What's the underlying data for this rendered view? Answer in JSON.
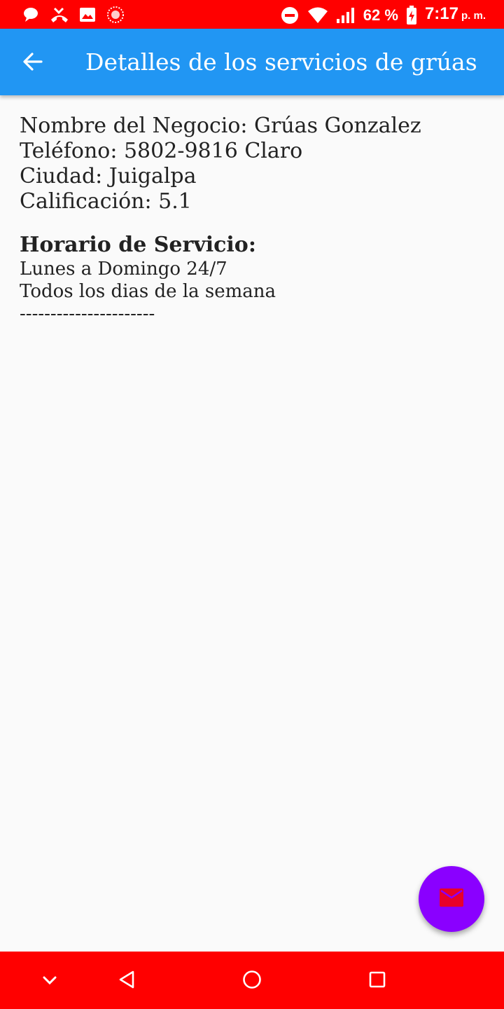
{
  "status_bar": {
    "battery_percent": "62 %",
    "time": "7:17",
    "time_suffix": "p. m.",
    "icons_left": [
      "chat-bubble-icon",
      "missed-call-icon",
      "image-icon",
      "recording-icon"
    ],
    "icons_right": [
      "do-not-disturb-icon",
      "wifi-icon",
      "signal-icon",
      "battery-charging-icon"
    ]
  },
  "app_bar": {
    "title": "Detalles de los servicios de grúas",
    "back_icon": "arrow-back-icon"
  },
  "details": {
    "business_name": "Nombre del Negocio: Grúas Gonzalez",
    "phone": "Teléfono: 5802-9816 Claro",
    "city": "Ciudad: Juigalpa",
    "rating": "Calificación: 5.1"
  },
  "schedule": {
    "title": "Horario de Servicio:",
    "line1": "Lunes a Domingo 24/7",
    "line2": "Todos los dias de la semana",
    "separator": "----------------------"
  },
  "fab": {
    "icon": "mail-icon"
  },
  "nav_bar": {
    "icons": [
      "chevron-down-icon",
      "back-triangle-icon",
      "home-circle-icon",
      "recents-square-icon"
    ]
  },
  "colors": {
    "status_bar": "#ff0000",
    "app_bar": "#2196f3",
    "fab": "#8a00ff",
    "fab_icon": "#e8002a",
    "nav_bar": "#ff0000",
    "background": "#fafafa"
  }
}
